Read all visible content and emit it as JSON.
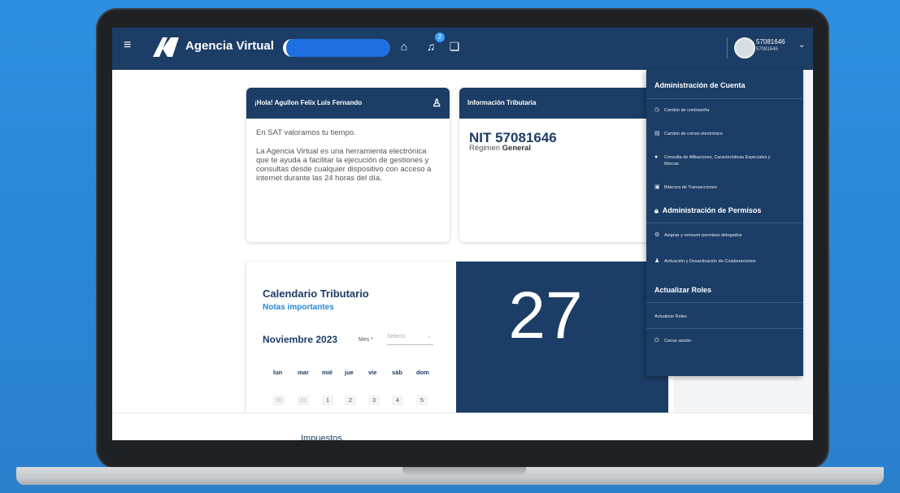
{
  "header": {
    "brand": "Agencia Virtual",
    "user_id": "57081646",
    "user_sub": "57081646",
    "notification_count": "2",
    "icons": [
      "hamburger-icon",
      "home-icon",
      "bell-icon",
      "chat-icon"
    ]
  },
  "greeting_card": {
    "title": "¡Hola! Agullon Felix Luis Fernando",
    "paragraph1": "En SAT valoramos tu tiempo.",
    "paragraph2": "La Agencia Virtual es una herramienta electrónica que te ayuda a facilitar la ejecución de gestiones y consultas desde cualquier dispositivo con acceso a internet durante las 24 horas del día."
  },
  "tax_card": {
    "title": "Información Tributaria",
    "nit": "NIT 57081646",
    "regimen_label": "Régimen",
    "regimen_value": "General"
  },
  "calendar": {
    "title": "Calendario Tributario",
    "link": "Notas importantes",
    "month": "Noviembre 2023",
    "mes_label": "Mes *",
    "select_placeholder": "Selecci",
    "weekdays": [
      "lun",
      "mar",
      "mié",
      "jue",
      "vie",
      "sáb",
      "dom"
    ],
    "days": [
      "30",
      "31",
      "1",
      "2",
      "3",
      "4",
      "5"
    ],
    "big_day": "27"
  },
  "bottom_strip": {
    "text": "Impuestos"
  },
  "account_menu": {
    "section1": "Administración de Cuenta",
    "item_password": "Cambio de contraseña",
    "item_email": "Cambio de correo electrónico",
    "item_affiliations": "Consulta de Afiliaciones, Características Especiales y Marcas",
    "item_log": "Bitácora de Transacciones",
    "section2": "Administración de Permisos",
    "item_permissions": "Asignar y remover permisos delegados",
    "item_collab": "Activación y Desactivación de Colaboraciones",
    "section3": "Actualizar Roles",
    "item_roles": "Actualizar Roles",
    "item_logout": "Cerrar sesión"
  },
  "colors": {
    "navy": "#1c3d66",
    "accent": "#2a86d6",
    "background": "#2e8fe0"
  }
}
